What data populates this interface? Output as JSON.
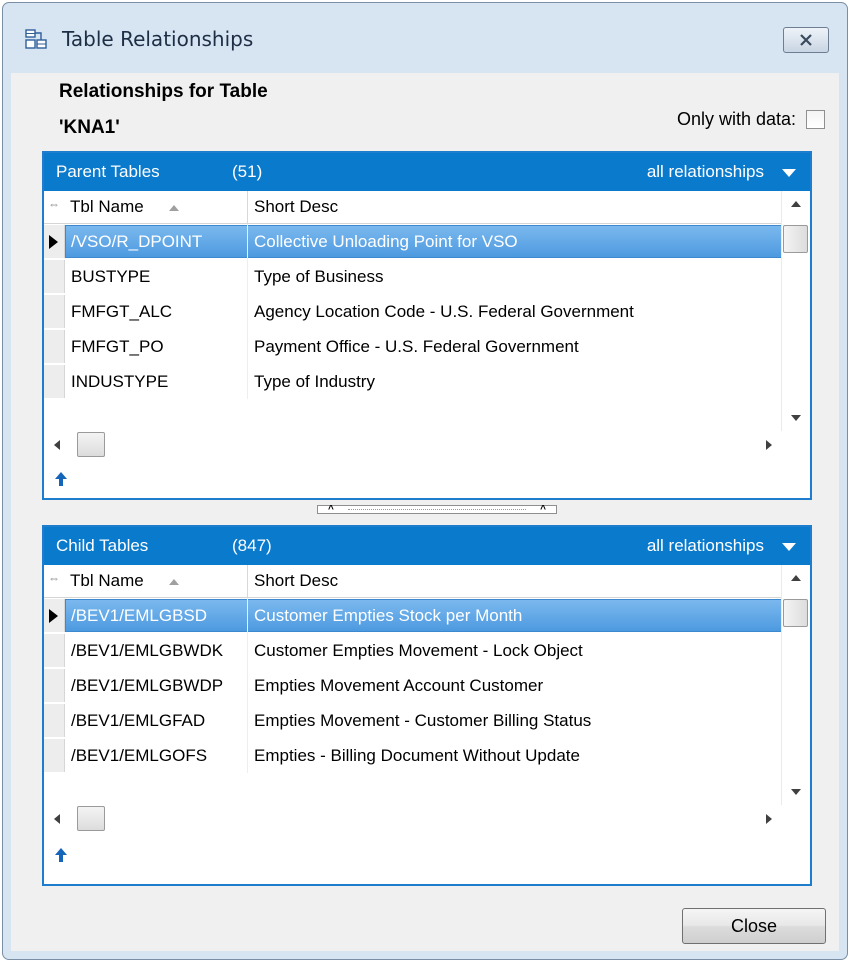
{
  "window": {
    "title": "Table Relationships",
    "close_label": "✖"
  },
  "heading": {
    "line1": "Relationships for Table",
    "line2": "'KNA1'"
  },
  "filter": {
    "only_with_data_label": "Only with data:",
    "only_with_data_checked": false
  },
  "parent": {
    "title": "Parent Tables",
    "count": "(51)",
    "filter_label": "all relationships",
    "col_name": "Tbl Name",
    "col_desc": "Short Desc",
    "rows": [
      {
        "name": "/VSO/R_DPOINT",
        "desc": "Collective Unloading Point for VSO"
      },
      {
        "name": "BUSTYPE",
        "desc": "Type of Business"
      },
      {
        "name": "FMFGT_ALC",
        "desc": "Agency Location Code - U.S. Federal Government"
      },
      {
        "name": "FMFGT_PO",
        "desc": "Payment Office - U.S. Federal Government"
      },
      {
        "name": "INDUSTYPE",
        "desc": "Type of Industry"
      }
    ]
  },
  "child": {
    "title": "Child Tables",
    "count": "(847)",
    "filter_label": "all relationships",
    "col_name": "Tbl Name",
    "col_desc": "Short Desc",
    "rows": [
      {
        "name": "/BEV1/EMLGBSD",
        "desc": "Customer Empties Stock per Month"
      },
      {
        "name": "/BEV1/EMLGBWDK",
        "desc": "Customer Empties Movement - Lock Object"
      },
      {
        "name": "/BEV1/EMLGBWDP",
        "desc": "Empties Movement Account Customer"
      },
      {
        "name": "/BEV1/EMLGFAD",
        "desc": "Empties Movement - Customer Billing Status"
      },
      {
        "name": "/BEV1/EMLGOFS",
        "desc": "Empties - Billing Document Without Update"
      }
    ]
  },
  "footer": {
    "close_button": "Close"
  },
  "colors": {
    "panel_header": "#0a7acd",
    "selection": "#4d9ae0",
    "window_frame": "#d7e4f2"
  }
}
